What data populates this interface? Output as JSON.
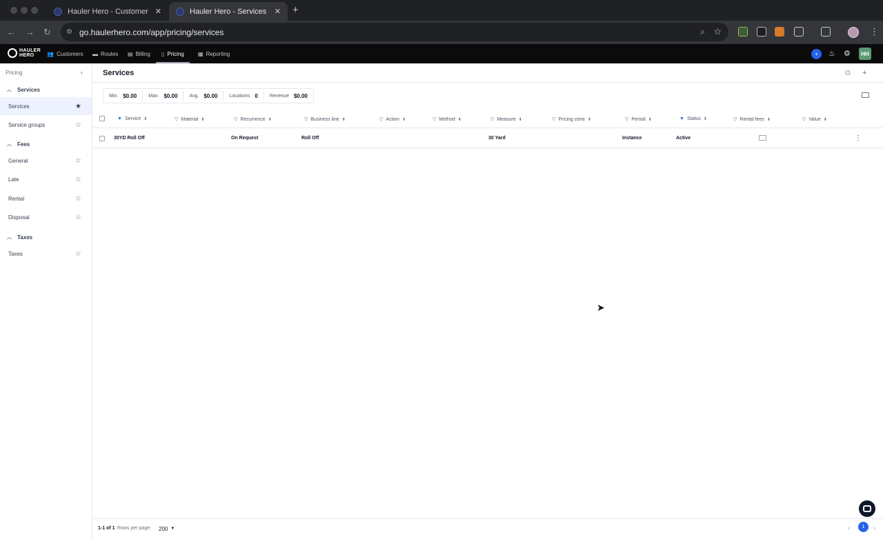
{
  "browser": {
    "tabs": [
      {
        "title": "Hauler Hero - Customer Deta",
        "active": false
      },
      {
        "title": "Hauler Hero - Services",
        "active": true
      }
    ],
    "new_tab_icon": "plus-icon",
    "url": "go.haulerhero.com/app/pricing/services"
  },
  "app": {
    "logo_line1": "HAULER",
    "logo_line2": "HERO",
    "nav": [
      {
        "label": "Customers",
        "icon": "people-icon"
      },
      {
        "label": "Routes",
        "icon": "truck-icon"
      },
      {
        "label": "Billing",
        "icon": "invoice-icon"
      },
      {
        "label": "Pricing",
        "icon": "price-tag-icon",
        "active": true
      },
      {
        "label": "Reporting",
        "icon": "report-icon"
      }
    ],
    "avatar_initials": "HH"
  },
  "sidebar": {
    "title": "Pricing",
    "sections": [
      {
        "label": "Services",
        "items": [
          {
            "label": "Services",
            "active": true
          },
          {
            "label": "Service groups"
          }
        ]
      },
      {
        "label": "Fees",
        "items": [
          {
            "label": "General"
          },
          {
            "label": "Late"
          },
          {
            "label": "Rental"
          },
          {
            "label": "Disposal"
          }
        ]
      },
      {
        "label": "Taxes",
        "items": [
          {
            "label": "Taxes"
          }
        ]
      }
    ]
  },
  "page": {
    "title": "Services",
    "stats": [
      {
        "label": "Min.",
        "value": "$0.00"
      },
      {
        "label": "Max.",
        "value": "$0.00"
      },
      {
        "label": "Avg.",
        "value": "$0.00"
      },
      {
        "label": "Locations",
        "value": "0"
      },
      {
        "label": "Revenue",
        "value": "$0.00"
      }
    ],
    "columns": [
      {
        "label": "Service",
        "filter_active": true
      },
      {
        "label": "Material",
        "filter_active": false
      },
      {
        "label": "Recurrence",
        "filter_active": false
      },
      {
        "label": "Business line",
        "filter_active": false
      },
      {
        "label": "Action",
        "filter_active": false
      },
      {
        "label": "Method",
        "filter_active": false
      },
      {
        "label": "Measure",
        "filter_active": false
      },
      {
        "label": "Pricing zone",
        "filter_active": false
      },
      {
        "label": "Period",
        "filter_active": false
      },
      {
        "label": "Status",
        "filter_active": true
      },
      {
        "label": "Rental fees",
        "filter_active": false
      },
      {
        "label": "Value",
        "filter_active": false
      }
    ],
    "rows": [
      {
        "service": "30YD Roll Off",
        "material": "",
        "recurrence": "On Request",
        "business_line": "Roll Off",
        "action": "",
        "method": "",
        "measure": "30 Yard",
        "pricing_zone": "",
        "period": "Instance",
        "status": "Active",
        "value": ""
      }
    ]
  },
  "footer": {
    "count": "1-1 of 1",
    "rows_per_page_label": "Rows per page:",
    "rows_per_page": "200",
    "current_page": "1"
  },
  "colors": {
    "accent": "#2563eb",
    "app_header": "#0b0b0c",
    "active_sidebar": "#eef2ff"
  }
}
